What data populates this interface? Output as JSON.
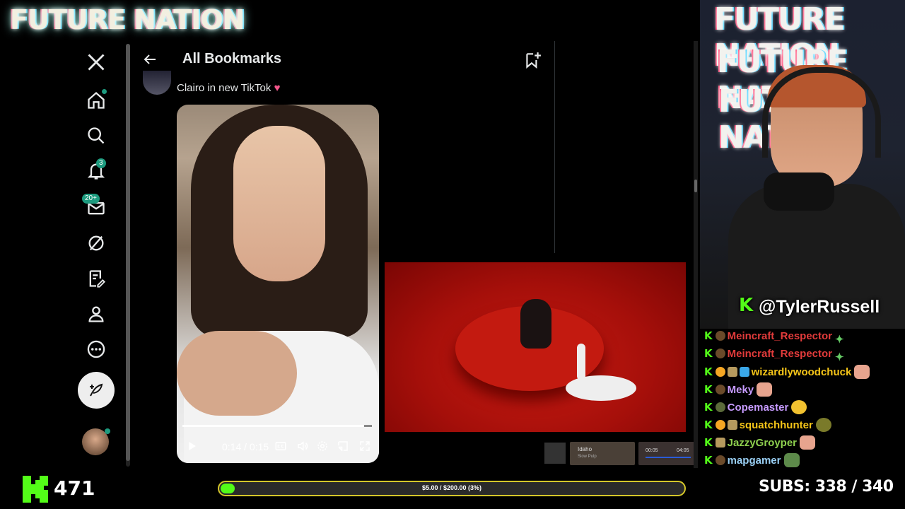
{
  "overlay": {
    "brand": "FUTURE NATION",
    "streamer_handle": "@TylerRussell",
    "viewer_count": "471",
    "goal_label": "$5.00 / $200.00 (3%)",
    "goal_progress": 0.03,
    "subs_label": "SUBS:",
    "subs_value": "338 / 340",
    "accent_color": "#53fc18"
  },
  "sidebar": {
    "items": [
      {
        "name": "x-logo"
      },
      {
        "name": "home"
      },
      {
        "name": "search"
      },
      {
        "name": "notifications",
        "badge": "3"
      },
      {
        "name": "messages",
        "badge": "20+"
      },
      {
        "name": "grok"
      },
      {
        "name": "lists"
      },
      {
        "name": "profile"
      },
      {
        "name": "more"
      }
    ]
  },
  "bookmarks": {
    "title": "All Bookmarks",
    "post_text": "Clairo in new TikTok",
    "heart": "♥",
    "video": {
      "time": "0:14 / 0:15",
      "progress": 0.96
    }
  },
  "now_playing": {
    "title": "Idaho",
    "artist": "Slow Pulp",
    "elapsed": "00:05",
    "duration": "04:05"
  },
  "chat": [
    {
      "user": "Meincraft_Respector",
      "color": "#e23b3b"
    },
    {
      "user": "Meincraft_Respector",
      "color": "#e23b3b"
    },
    {
      "user": "wizardlywoodchuck",
      "color": "#f5c518"
    },
    {
      "user": "Meky",
      "color": "#c79bff"
    },
    {
      "user": "Copemaster",
      "color": "#c79bff"
    },
    {
      "user": "squatchhunter",
      "color": "#f5c518"
    },
    {
      "user": "JazzyGroyper",
      "color": "#8fd14f"
    },
    {
      "user": "mapgamer",
      "color": "#9ad0f5"
    }
  ]
}
